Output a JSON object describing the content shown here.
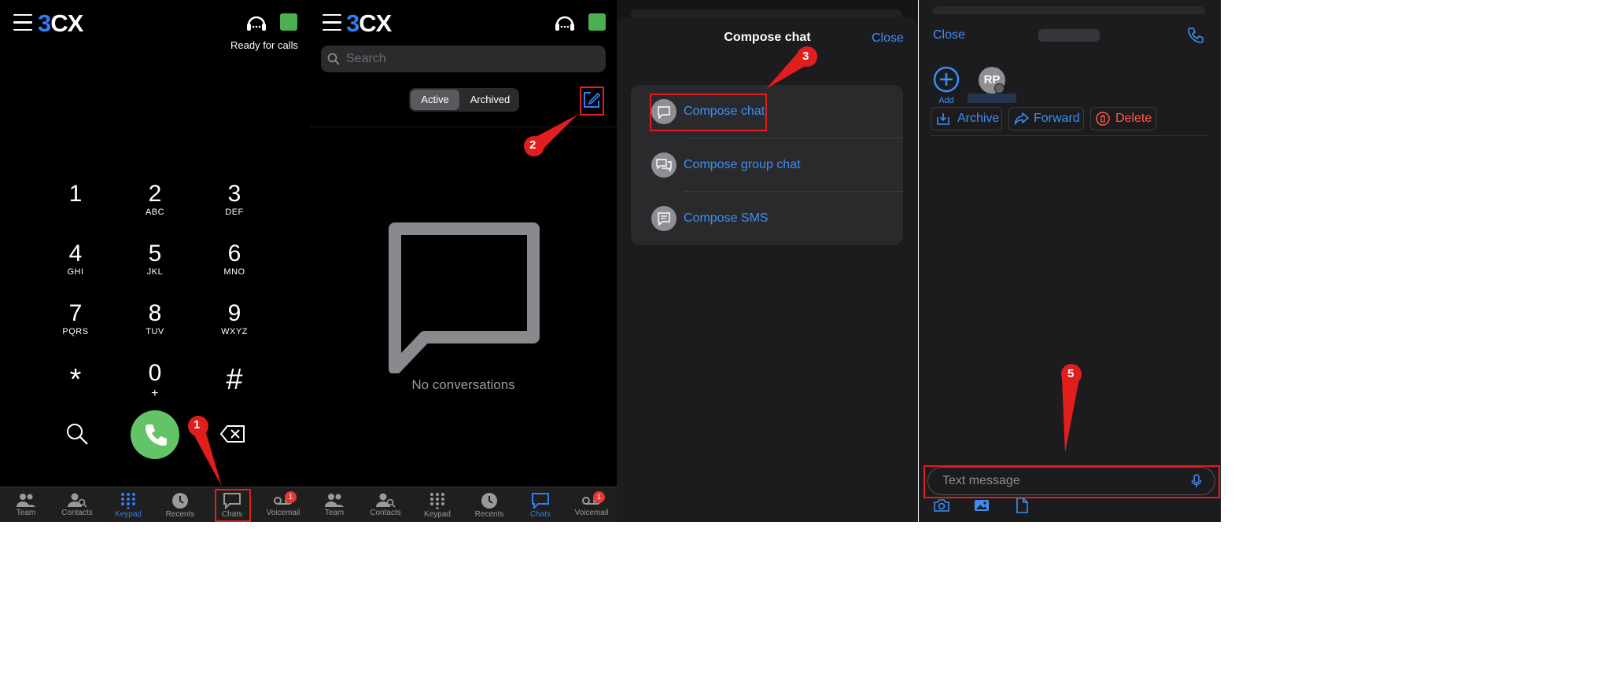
{
  "app": {
    "logo_part1": "3",
    "logo_part2": "CX"
  },
  "colors": {
    "accent": "#2f7df6",
    "link": "#3d8ef5",
    "status_green": "#4caf50",
    "call_green": "#62c466",
    "annotation_red": "#e01e1e",
    "delete_red": "#ff5a4f"
  },
  "keypad_screen": {
    "status_text": "Ready for calls",
    "keys": [
      {
        "digit": "1",
        "letters": ""
      },
      {
        "digit": "2",
        "letters": "ABC"
      },
      {
        "digit": "3",
        "letters": "DEF"
      },
      {
        "digit": "4",
        "letters": "GHI"
      },
      {
        "digit": "5",
        "letters": "JKL"
      },
      {
        "digit": "6",
        "letters": "MNO"
      },
      {
        "digit": "7",
        "letters": "PQRS"
      },
      {
        "digit": "8",
        "letters": "TUV"
      },
      {
        "digit": "9",
        "letters": "WXYZ"
      },
      {
        "digit": "*",
        "letters": ""
      },
      {
        "digit": "0",
        "letters": "+"
      },
      {
        "digit": "#",
        "letters": ""
      }
    ]
  },
  "tabbar": {
    "tabs": [
      "Team",
      "Contacts",
      "Keypad",
      "Recents",
      "Chats",
      "Voicemail"
    ],
    "voicemail_badge": "1"
  },
  "chats_screen": {
    "search_placeholder": "Search",
    "segments": [
      "Active",
      "Archived"
    ],
    "empty_text": "No conversations"
  },
  "compose_screen": {
    "title": "Compose chat",
    "close_label": "Close",
    "options": [
      "Compose chat",
      "Compose group chat",
      "Compose SMS"
    ]
  },
  "conversation_screen": {
    "close_label": "Close",
    "add_label": "Add",
    "participant_initials": "RP",
    "actions": [
      "Archive",
      "Forward",
      "Delete"
    ],
    "message_placeholder": "Text message"
  },
  "annotations": [
    "1",
    "2",
    "3",
    "5"
  ]
}
